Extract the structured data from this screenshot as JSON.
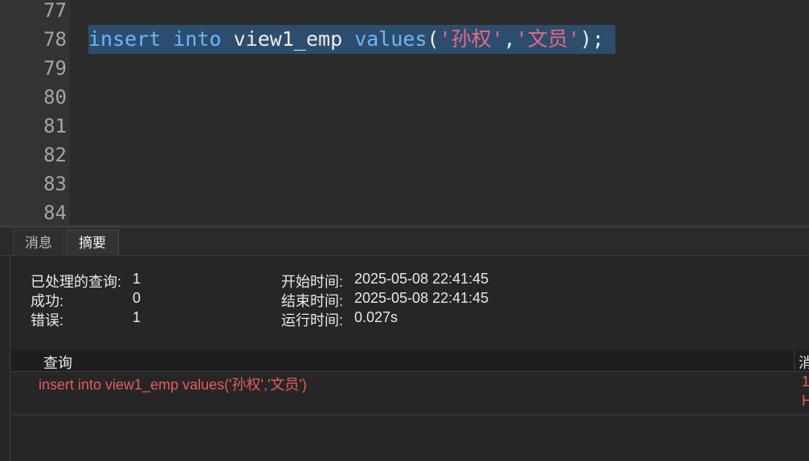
{
  "editor": {
    "line_numbers": [
      "77",
      "78",
      "79",
      "80",
      "81",
      "82",
      "83",
      "84"
    ],
    "sql": {
      "kw_insert": "insert",
      "kw_into": "into",
      "table": "view1_emp",
      "kw_values": "values",
      "open": "(",
      "str1": "'孙权'",
      "comma": ",",
      "str2": "'文员'",
      "close": ");"
    }
  },
  "tabs": {
    "messages": "消息",
    "summary": "摘要"
  },
  "summary": {
    "processed_label": "已处理的查询:",
    "processed_value": "1",
    "success_label": "成功:",
    "success_value": "0",
    "error_label": "错误:",
    "error_value": "1",
    "start_label": "开始时间:",
    "start_value": "2025-05-08 22:41:45",
    "end_label": "结束时间:",
    "end_value": "2025-05-08 22:41:45",
    "run_label": "运行时间:",
    "run_value": "0.027s"
  },
  "grid": {
    "col_query": "查询",
    "col_message": "消",
    "row_query": "insert into view1_emp values('孙权','文员')",
    "row_message_1": "1",
    "row_message_2": "H"
  },
  "colors": {
    "editor_bg": "#2b2b2b",
    "selection": "#2d4d6e",
    "keyword": "#6cb5f7",
    "string": "#e66a80",
    "error_text": "#e85c5c"
  }
}
